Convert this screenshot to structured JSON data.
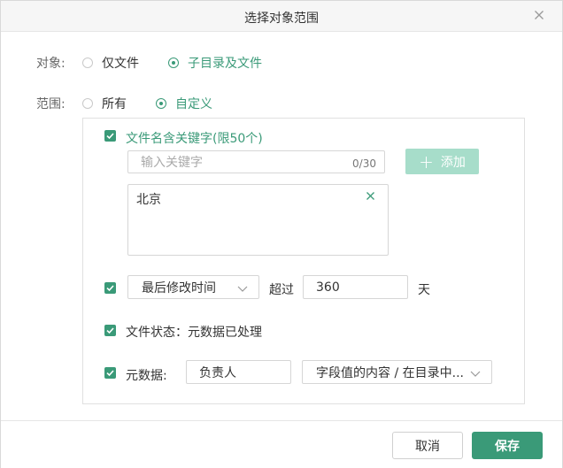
{
  "dialog": {
    "title": "选择对象范围"
  },
  "object": {
    "label": "对象:",
    "options": [
      {
        "label": "仅文件",
        "selected": false
      },
      {
        "label": "子目录及文件",
        "selected": true
      }
    ]
  },
  "scope": {
    "label": "范围:",
    "options": [
      {
        "label": "所有",
        "selected": false
      },
      {
        "label": "自定义",
        "selected": true
      }
    ]
  },
  "keyword": {
    "checked": true,
    "label": "文件名含关键字(限50个)",
    "input_placeholder": "输入关键字",
    "counter": "0/30",
    "add_label": "添加",
    "tags": [
      "北京"
    ]
  },
  "modified": {
    "checked": true,
    "select_value": "最后修改时间",
    "exceed_label": "超过",
    "value": "360",
    "unit": "天"
  },
  "status": {
    "checked": true,
    "label": "文件状态：元数据已处理"
  },
  "metadata": {
    "checked": true,
    "label": "元数据:",
    "field_value": "负责人",
    "select_value": "字段值的内容 / 在目录中..."
  },
  "footer": {
    "cancel_label": "取消",
    "save_label": "保存"
  },
  "colors": {
    "accent": "#3a9a78",
    "accent_light": "#a7ddca"
  }
}
